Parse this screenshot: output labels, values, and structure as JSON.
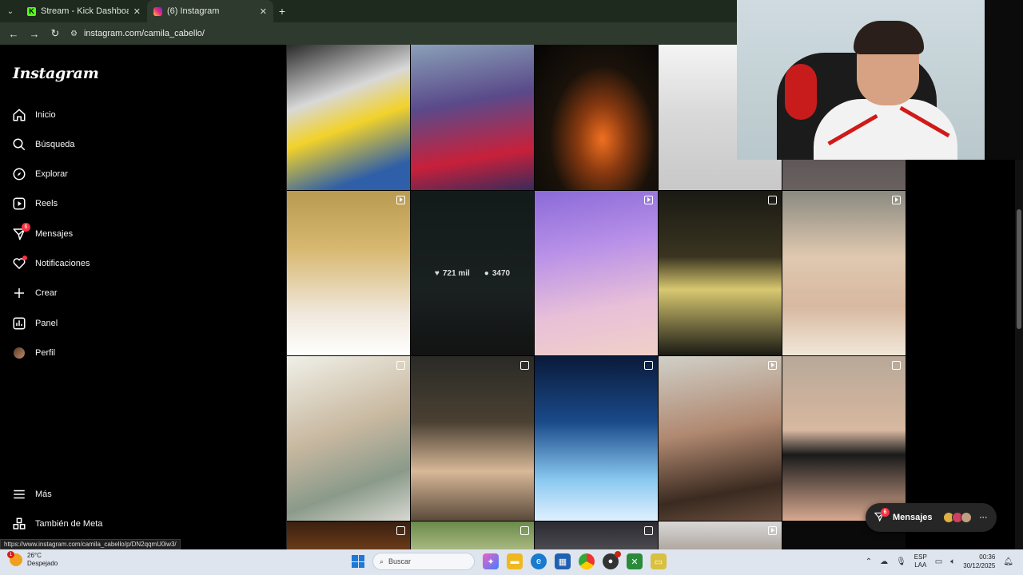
{
  "browser": {
    "tabs": [
      {
        "title": "Stream - Kick Dashboard",
        "active": false,
        "favicon": "kick-logo"
      },
      {
        "title": "(6) Instagram",
        "active": true,
        "favicon": "instagram-logo"
      }
    ],
    "url": "instagram.com/camila_cabello/"
  },
  "sidebar": {
    "logo": "Instagram",
    "items": [
      {
        "label": "Inicio",
        "icon": "home-icon"
      },
      {
        "label": "Búsqueda",
        "icon": "search-icon"
      },
      {
        "label": "Explorar",
        "icon": "compass-icon"
      },
      {
        "label": "Reels",
        "icon": "reels-icon"
      },
      {
        "label": "Mensajes",
        "icon": "messenger-icon",
        "badge": "6"
      },
      {
        "label": "Notificaciones",
        "icon": "heart-icon",
        "dot": true
      },
      {
        "label": "Crear",
        "icon": "plus-icon"
      },
      {
        "label": "Panel",
        "icon": "chart-icon"
      },
      {
        "label": "Perfil",
        "icon": "avatar"
      }
    ],
    "bottom": [
      {
        "label": "Más",
        "icon": "menu-icon"
      },
      {
        "label": "También de Meta",
        "icon": "meta-icon"
      }
    ]
  },
  "grid": {
    "hovered_post": {
      "likes": "721 mil",
      "comments": "3470"
    }
  },
  "messages_pill": {
    "label": "Mensajes",
    "badge": "6"
  },
  "status_url": "https://www.instagram.com/camila_cabello/p/DN2qqmU0iw3/",
  "taskbar": {
    "weather_temp": "26°C",
    "weather_desc": "Despejado",
    "weather_badge": "1",
    "search_placeholder": "Buscar",
    "lang_top": "ESP",
    "lang_bottom": "LAA",
    "time": "00:36",
    "date": "30/12/2025"
  }
}
